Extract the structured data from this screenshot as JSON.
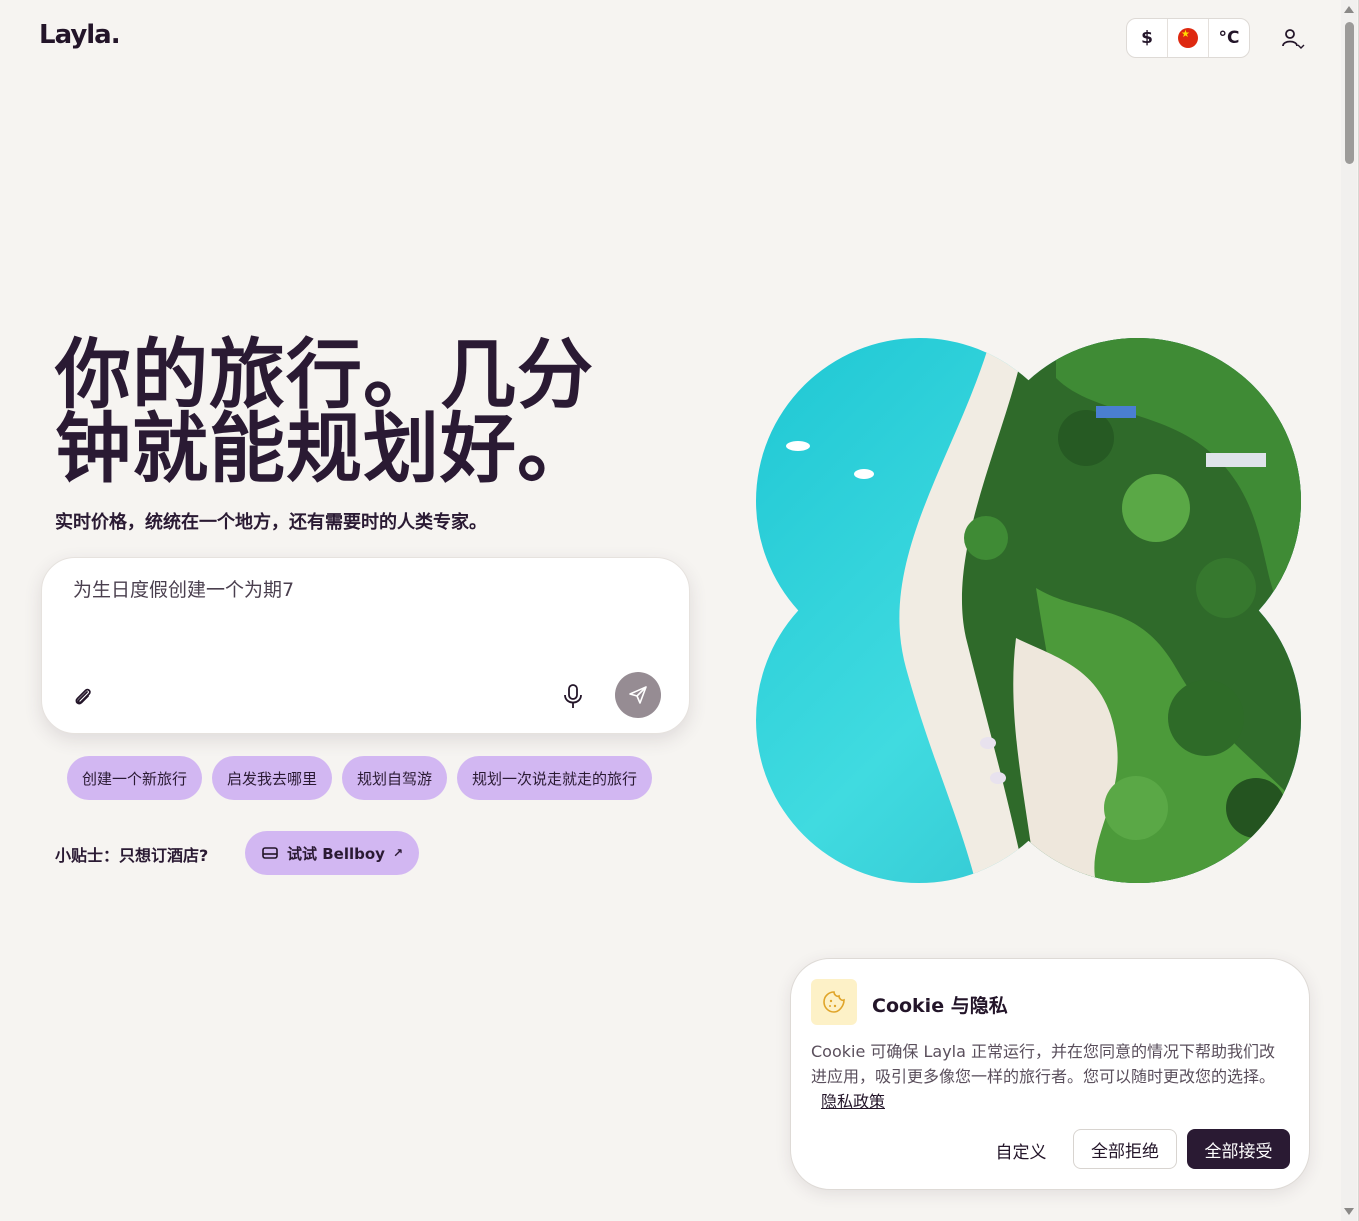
{
  "header": {
    "logo": "Layla.",
    "currency_label": "$",
    "language_icon": "china-flag-icon",
    "temperature_label": "°C",
    "user_icon": "user-icon"
  },
  "hero": {
    "headline_line1": "你的旅行。几分",
    "headline_line2": "钟就能规划好。",
    "subheadline": "实时价格，统统在一个地方，还有需要时的人类专家。"
  },
  "composer": {
    "input_value": "为生日度假创建一个为期7",
    "attach_icon": "paperclip-icon",
    "mic_icon": "microphone-icon",
    "send_icon": "send-icon"
  },
  "suggestions": [
    "创建一个新旅行",
    "启发我去哪里",
    "规划自驾游",
    "规划一次说走就走的旅行"
  ],
  "tip": {
    "label": "小贴士：只想订酒店?",
    "button_label": "试试 Bellboy",
    "button_icon": "bed-icon",
    "arrow_icon": "arrow-up-right-icon"
  },
  "image": {
    "description_icon": "tropical-island-aerial-image"
  },
  "cookie_banner": {
    "icon": "cookie-icon",
    "title": "Cookie 与隐私",
    "body": "Cookie 可确保 Layla 正常运行，并在您同意的情况下帮助我们改进应用，吸引更多像您一样的旅行者。您可以随时更改您的选择。",
    "privacy_link": "隐私政策",
    "customize_label": "自定义",
    "reject_label": "全部拒绝",
    "accept_label": "全部接受"
  },
  "colors": {
    "background": "#f6f4f1",
    "primary_text": "#2a1a33",
    "chip_purple": "#d2b7f2",
    "accept_button": "#2a1a33",
    "send_button": "#968c93"
  }
}
